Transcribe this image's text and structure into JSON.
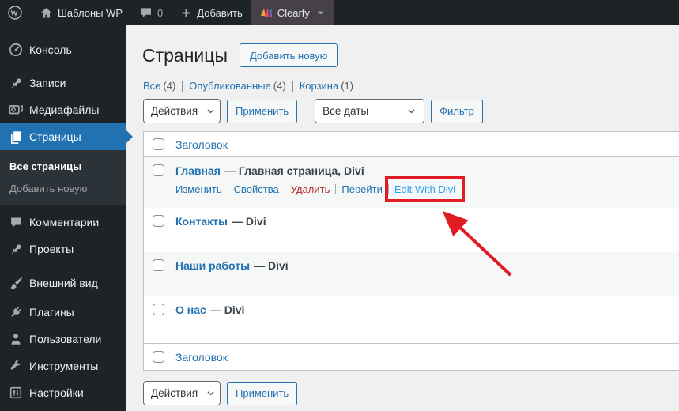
{
  "admin_bar": {
    "site_name": "Шаблоны WP",
    "comments_count": "0",
    "new_content_label": "Добавить",
    "clearfy_label": "Clearfy",
    "icons": [
      "wp-logo-icon",
      "home-icon",
      "comments-bubble-icon",
      "plus-icon",
      "clearfy-logo-icon",
      "chevron-down-icon"
    ]
  },
  "sidebar": {
    "items": [
      {
        "label": "Консоль",
        "icon": "dashboard-icon"
      },
      {
        "label": "Записи",
        "icon": "pushpin-icon"
      },
      {
        "label": "Медиафайлы",
        "icon": "media-icon"
      },
      {
        "label": "Страницы",
        "icon": "pages-icon",
        "active": true
      },
      {
        "label": "Комментарии",
        "icon": "comments-bubble-icon"
      },
      {
        "label": "Проекты",
        "icon": "pushpin-icon"
      },
      {
        "label": "Внешний вид",
        "icon": "paintbrush-icon"
      },
      {
        "label": "Плагины",
        "icon": "plug-icon"
      },
      {
        "label": "Пользователи",
        "icon": "user-icon"
      },
      {
        "label": "Инструменты",
        "icon": "wrench-icon"
      },
      {
        "label": "Настройки",
        "icon": "settings-icon"
      }
    ],
    "pages_submenu": [
      {
        "label": "Все страницы",
        "current": true
      },
      {
        "label": "Добавить новую",
        "current": false
      }
    ]
  },
  "main": {
    "page_title": "Страницы",
    "add_new_button": "Добавить новую",
    "status_filters": [
      {
        "label": "Все",
        "count": "(4)"
      },
      {
        "label": "Опубликованные",
        "count": "(4)"
      },
      {
        "label": "Корзина",
        "count": "(1)"
      }
    ],
    "bulk_actions_select": "Действия",
    "apply_button": "Применить",
    "dates_select": "Все даты",
    "filter_button": "Фильтр",
    "column_header": "Заголовок",
    "column_footer": "Заголовок",
    "rows": [
      {
        "title": "Главная",
        "state": "— Главная страница, Divi",
        "actions": {
          "edit": "Изменить",
          "properties": "Свойства",
          "trash": "Удалить",
          "view": "Перейти",
          "divi": "Edit With Divi"
        }
      },
      {
        "title": "Контакты",
        "state": "— Divi"
      },
      {
        "title": "Наши работы",
        "state": "— Divi"
      },
      {
        "title": "О нас",
        "state": "— Divi"
      }
    ]
  },
  "annotation": {
    "highlight_target": "Edit With Divi",
    "shape": "red-box-with-arrow",
    "color": "#e11b22"
  },
  "colors": {
    "admin_dark": "#1d2327",
    "submenu_dark": "#2c3338",
    "accent_blue": "#2271b1",
    "divi_link_blue": "#2ea3f2",
    "delete_red": "#b32d2e",
    "annotation_red": "#e11b22",
    "content_bg": "#f0f0f1",
    "stripe_bg": "#f6f7f7",
    "clearfy_item_bg": "#464049"
  }
}
